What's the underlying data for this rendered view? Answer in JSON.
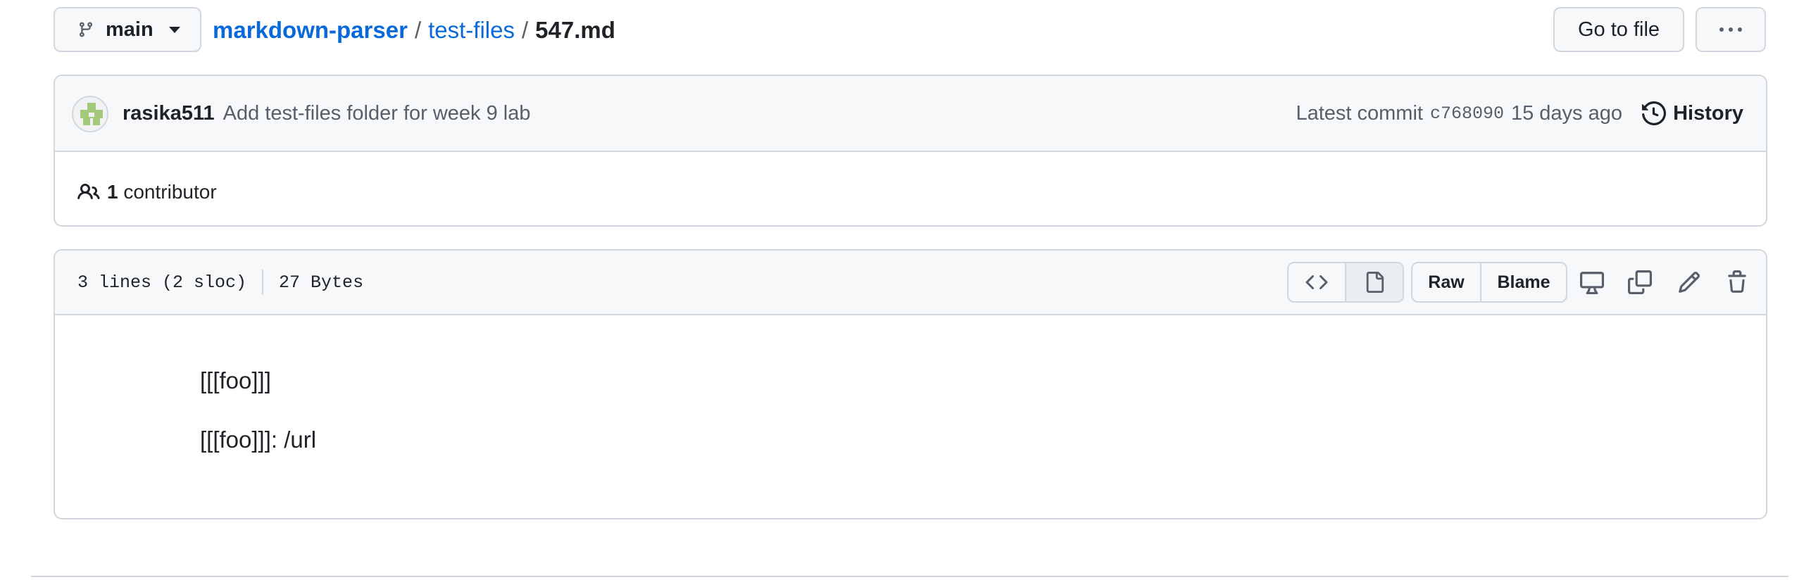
{
  "branch": {
    "label": "main"
  },
  "breadcrumb": {
    "repo": "markdown-parser",
    "folder": "test-files",
    "file": "547.md",
    "separator": "/"
  },
  "actions": {
    "go_to_file": "Go to file",
    "more_icon": "kebab-horizontal-icon"
  },
  "commit": {
    "author": "rasika511",
    "message": "Add test-files folder for week 9 lab",
    "latest_label": "Latest commit",
    "sha": "c768090",
    "age": "15 days ago",
    "history_label": "History"
  },
  "contributors": {
    "count": "1",
    "label": "contributor"
  },
  "file": {
    "lines": "3 lines (2 sloc)",
    "size": "27 Bytes",
    "raw_label": "Raw",
    "blame_label": "Blame",
    "content": [
      "[[[foo]]]",
      "[[[foo]]]: /url"
    ]
  },
  "colors": {
    "link": "#0969da",
    "border": "#d0d7de",
    "header_bg": "#f6f8fa",
    "text": "#1f2328",
    "muted": "#57606a"
  }
}
